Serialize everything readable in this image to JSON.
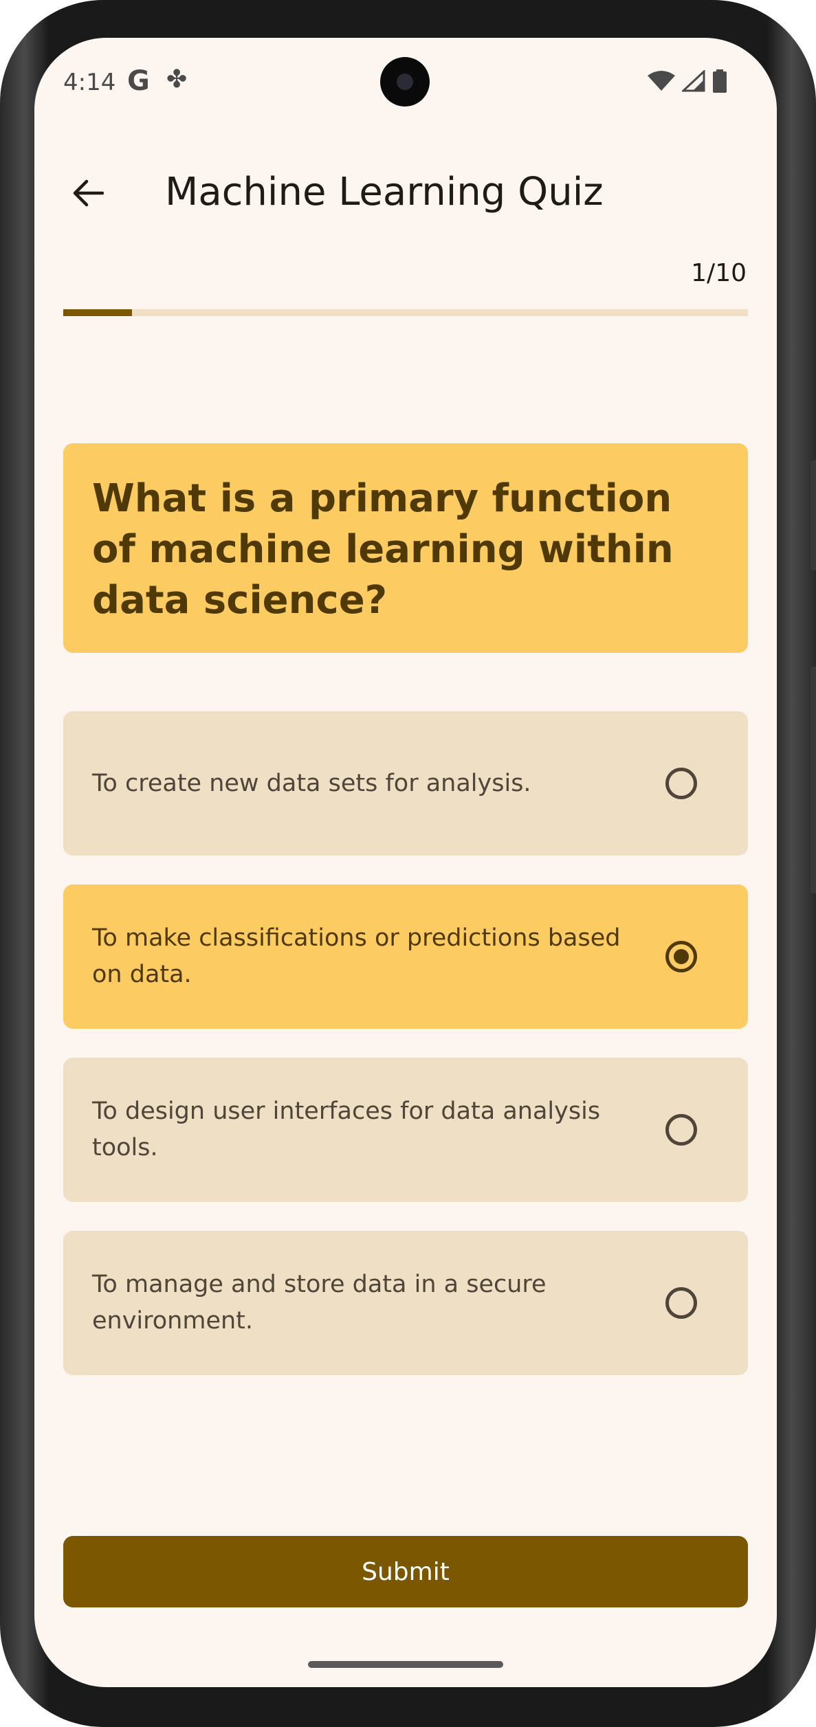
{
  "status_bar": {
    "time": "4:14",
    "notification_icons": [
      "google-g-icon",
      "pinwheel-icon"
    ],
    "system_icons": [
      "wifi-icon",
      "signal-icon",
      "battery-icon"
    ],
    "g_glyph": "G",
    "fan_glyph": "✤"
  },
  "app_bar": {
    "title": "Machine Learning Quiz",
    "back_icon": "arrow-back-icon"
  },
  "progress": {
    "label": "1/10",
    "current": 1,
    "total": 10,
    "fraction": 0.1
  },
  "question": {
    "text": "What is a primary function of machine learning within data science?"
  },
  "options": [
    {
      "text": "To create new data sets for analysis.",
      "selected": false
    },
    {
      "text": "To make classifications or predictions based on data.",
      "selected": true
    },
    {
      "text": "To design user interfaces for data analysis tools.",
      "selected": false
    },
    {
      "text": "To manage and store data in a secure environment.",
      "selected": false
    }
  ],
  "submit": {
    "label": "Submit"
  },
  "colors": {
    "background": "#fcf5f0",
    "accent": "#7a5700",
    "question_card": "#fccb62",
    "option_card": "#efdfc4",
    "selected_option": "#fccb62"
  }
}
